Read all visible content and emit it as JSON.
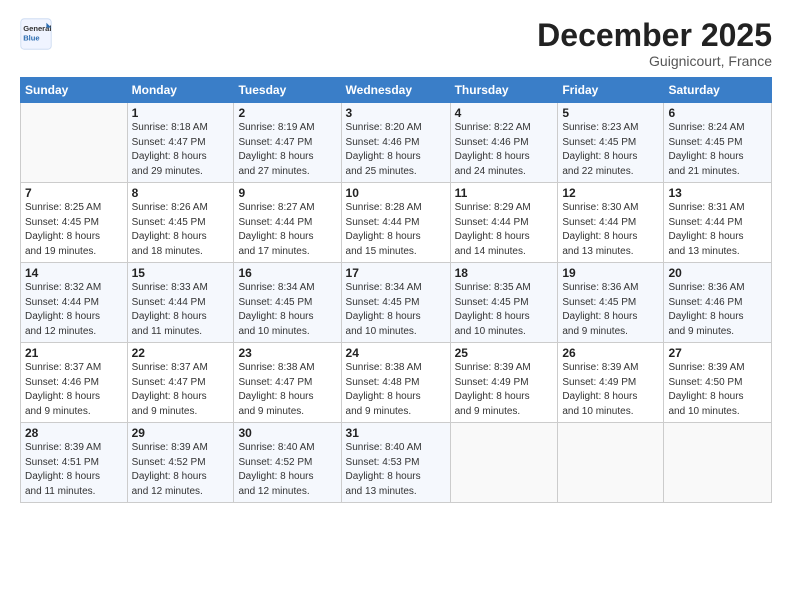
{
  "header": {
    "logo_general": "General",
    "logo_blue": "Blue",
    "month_title": "December 2025",
    "location": "Guignicourt, France"
  },
  "days_of_week": [
    "Sunday",
    "Monday",
    "Tuesday",
    "Wednesday",
    "Thursday",
    "Friday",
    "Saturday"
  ],
  "weeks": [
    [
      {
        "day": "",
        "detail": ""
      },
      {
        "day": "1",
        "detail": "Sunrise: 8:18 AM\nSunset: 4:47 PM\nDaylight: 8 hours\nand 29 minutes."
      },
      {
        "day": "2",
        "detail": "Sunrise: 8:19 AM\nSunset: 4:47 PM\nDaylight: 8 hours\nand 27 minutes."
      },
      {
        "day": "3",
        "detail": "Sunrise: 8:20 AM\nSunset: 4:46 PM\nDaylight: 8 hours\nand 25 minutes."
      },
      {
        "day": "4",
        "detail": "Sunrise: 8:22 AM\nSunset: 4:46 PM\nDaylight: 8 hours\nand 24 minutes."
      },
      {
        "day": "5",
        "detail": "Sunrise: 8:23 AM\nSunset: 4:45 PM\nDaylight: 8 hours\nand 22 minutes."
      },
      {
        "day": "6",
        "detail": "Sunrise: 8:24 AM\nSunset: 4:45 PM\nDaylight: 8 hours\nand 21 minutes."
      }
    ],
    [
      {
        "day": "7",
        "detail": "Sunrise: 8:25 AM\nSunset: 4:45 PM\nDaylight: 8 hours\nand 19 minutes."
      },
      {
        "day": "8",
        "detail": "Sunrise: 8:26 AM\nSunset: 4:45 PM\nDaylight: 8 hours\nand 18 minutes."
      },
      {
        "day": "9",
        "detail": "Sunrise: 8:27 AM\nSunset: 4:44 PM\nDaylight: 8 hours\nand 17 minutes."
      },
      {
        "day": "10",
        "detail": "Sunrise: 8:28 AM\nSunset: 4:44 PM\nDaylight: 8 hours\nand 15 minutes."
      },
      {
        "day": "11",
        "detail": "Sunrise: 8:29 AM\nSunset: 4:44 PM\nDaylight: 8 hours\nand 14 minutes."
      },
      {
        "day": "12",
        "detail": "Sunrise: 8:30 AM\nSunset: 4:44 PM\nDaylight: 8 hours\nand 13 minutes."
      },
      {
        "day": "13",
        "detail": "Sunrise: 8:31 AM\nSunset: 4:44 PM\nDaylight: 8 hours\nand 13 minutes."
      }
    ],
    [
      {
        "day": "14",
        "detail": "Sunrise: 8:32 AM\nSunset: 4:44 PM\nDaylight: 8 hours\nand 12 minutes."
      },
      {
        "day": "15",
        "detail": "Sunrise: 8:33 AM\nSunset: 4:44 PM\nDaylight: 8 hours\nand 11 minutes."
      },
      {
        "day": "16",
        "detail": "Sunrise: 8:34 AM\nSunset: 4:45 PM\nDaylight: 8 hours\nand 10 minutes."
      },
      {
        "day": "17",
        "detail": "Sunrise: 8:34 AM\nSunset: 4:45 PM\nDaylight: 8 hours\nand 10 minutes."
      },
      {
        "day": "18",
        "detail": "Sunrise: 8:35 AM\nSunset: 4:45 PM\nDaylight: 8 hours\nand 10 minutes."
      },
      {
        "day": "19",
        "detail": "Sunrise: 8:36 AM\nSunset: 4:45 PM\nDaylight: 8 hours\nand 9 minutes."
      },
      {
        "day": "20",
        "detail": "Sunrise: 8:36 AM\nSunset: 4:46 PM\nDaylight: 8 hours\nand 9 minutes."
      }
    ],
    [
      {
        "day": "21",
        "detail": "Sunrise: 8:37 AM\nSunset: 4:46 PM\nDaylight: 8 hours\nand 9 minutes."
      },
      {
        "day": "22",
        "detail": "Sunrise: 8:37 AM\nSunset: 4:47 PM\nDaylight: 8 hours\nand 9 minutes."
      },
      {
        "day": "23",
        "detail": "Sunrise: 8:38 AM\nSunset: 4:47 PM\nDaylight: 8 hours\nand 9 minutes."
      },
      {
        "day": "24",
        "detail": "Sunrise: 8:38 AM\nSunset: 4:48 PM\nDaylight: 8 hours\nand 9 minutes."
      },
      {
        "day": "25",
        "detail": "Sunrise: 8:39 AM\nSunset: 4:49 PM\nDaylight: 8 hours\nand 9 minutes."
      },
      {
        "day": "26",
        "detail": "Sunrise: 8:39 AM\nSunset: 4:49 PM\nDaylight: 8 hours\nand 10 minutes."
      },
      {
        "day": "27",
        "detail": "Sunrise: 8:39 AM\nSunset: 4:50 PM\nDaylight: 8 hours\nand 10 minutes."
      }
    ],
    [
      {
        "day": "28",
        "detail": "Sunrise: 8:39 AM\nSunset: 4:51 PM\nDaylight: 8 hours\nand 11 minutes."
      },
      {
        "day": "29",
        "detail": "Sunrise: 8:39 AM\nSunset: 4:52 PM\nDaylight: 8 hours\nand 12 minutes."
      },
      {
        "day": "30",
        "detail": "Sunrise: 8:40 AM\nSunset: 4:52 PM\nDaylight: 8 hours\nand 12 minutes."
      },
      {
        "day": "31",
        "detail": "Sunrise: 8:40 AM\nSunset: 4:53 PM\nDaylight: 8 hours\nand 13 minutes."
      },
      {
        "day": "",
        "detail": ""
      },
      {
        "day": "",
        "detail": ""
      },
      {
        "day": "",
        "detail": ""
      }
    ]
  ]
}
